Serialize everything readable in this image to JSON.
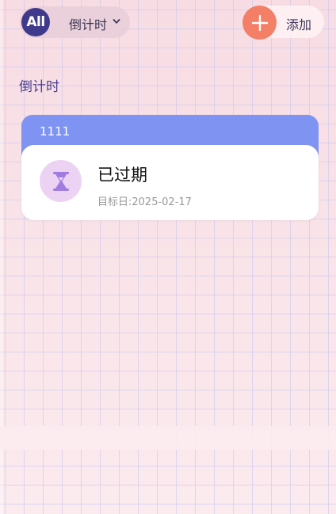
{
  "header": {
    "filter": {
      "badge": "All",
      "label": "倒计时"
    },
    "add_label": "添加"
  },
  "section": {
    "title": "倒计时"
  },
  "countdowns": [
    {
      "name": "1111",
      "status": "已过期",
      "target_date": "目标日:2025-02-17",
      "icon": "hourglass-icon"
    }
  ],
  "colors": {
    "badge": "#3f3a8c",
    "add_button": "#f47f67",
    "card_header": "#7f93f3",
    "icon_bg": "#ecd3f4",
    "icon": "#a27be0",
    "section_title": "#4a3f8f"
  }
}
